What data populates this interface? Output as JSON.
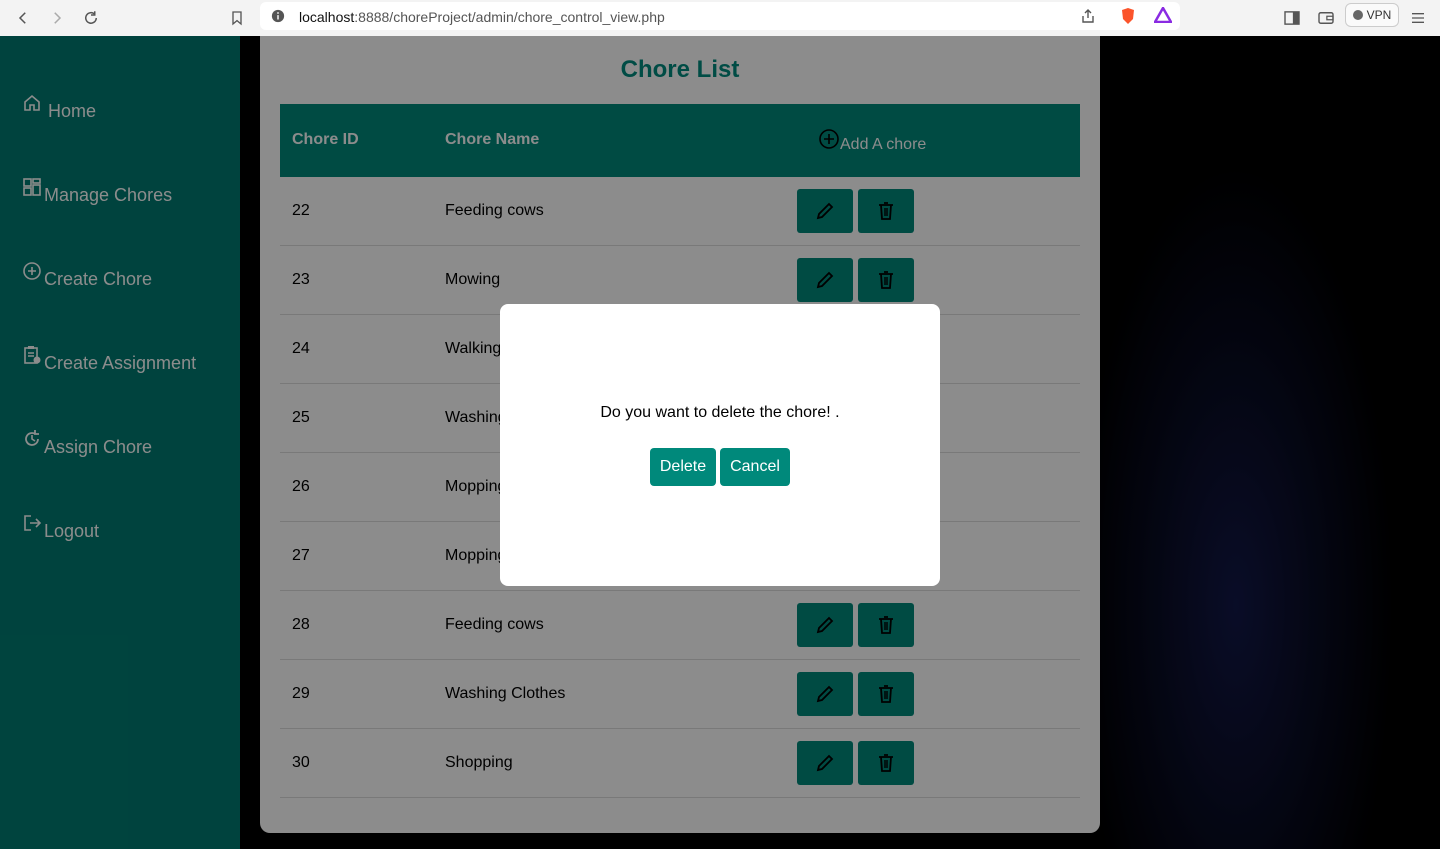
{
  "browser": {
    "url_host": "localhost",
    "url_rest": ":8888/choreProject/admin/chore_control_view.php",
    "vpn_label": "VPN"
  },
  "sidebar": {
    "items": [
      {
        "label": "Home",
        "icon": "home-icon"
      },
      {
        "label": "Manage Chores",
        "icon": "dashboard-icon"
      },
      {
        "label": "Create Chore",
        "icon": "plus-circle-icon"
      },
      {
        "label": "Create Assignment",
        "icon": "clipboard-icon"
      },
      {
        "label": "Assign Chore",
        "icon": "refresh-icon"
      },
      {
        "label": "Logout",
        "icon": "logout-icon"
      }
    ]
  },
  "main": {
    "title": "Chore List",
    "headers": {
      "id": "Chore ID",
      "name": "Chore Name",
      "add": "Add A chore"
    },
    "rows": [
      {
        "id": "22",
        "name": "Feeding cows"
      },
      {
        "id": "23",
        "name": "Mowing"
      },
      {
        "id": "24",
        "name": "Walking"
      },
      {
        "id": "25",
        "name": "Washing"
      },
      {
        "id": "26",
        "name": "Mopping"
      },
      {
        "id": "27",
        "name": "Mopping"
      },
      {
        "id": "28",
        "name": "Feeding cows"
      },
      {
        "id": "29",
        "name": "Washing Clothes"
      },
      {
        "id": "30",
        "name": "Shopping"
      }
    ]
  },
  "modal": {
    "message": "Do you want to delete the chore! .",
    "delete_label": "Delete",
    "cancel_label": "Cancel"
  },
  "colors": {
    "accent": "#00897b",
    "sidebar": "#007b71"
  }
}
